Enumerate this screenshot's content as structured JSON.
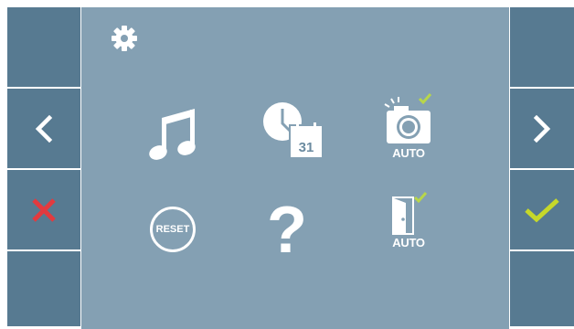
{
  "main": {
    "items": [
      {
        "name": "melody",
        "icon": "music-note-icon"
      },
      {
        "name": "date-time",
        "icon": "clock-calendar-icon",
        "calendar_day": "31"
      },
      {
        "name": "camera-auto",
        "icon": "camera-icon",
        "label": "AUTO",
        "checked": true
      },
      {
        "name": "reset",
        "icon": "reset-icon",
        "label": "RESET"
      },
      {
        "name": "help",
        "icon": "help-icon",
        "label": "?"
      },
      {
        "name": "door-auto",
        "icon": "door-icon",
        "label": "AUTO",
        "checked": true
      }
    ]
  },
  "left_panel": {
    "buttons": [
      {
        "name": "blank",
        "icon": ""
      },
      {
        "name": "prev",
        "icon": "chevron-left-icon"
      },
      {
        "name": "cancel",
        "icon": "close-icon"
      },
      {
        "name": "blank",
        "icon": ""
      }
    ]
  },
  "right_panel": {
    "buttons": [
      {
        "name": "blank",
        "icon": ""
      },
      {
        "name": "next",
        "icon": "chevron-right-icon"
      },
      {
        "name": "confirm",
        "icon": "check-icon"
      },
      {
        "name": "blank",
        "icon": ""
      }
    ]
  },
  "colors": {
    "panel": "#577a91",
    "main_bg": "#84a0b3",
    "icon": "#ffffff",
    "cancel": "#e23a3f",
    "confirm": "#c6d82a",
    "check_badge": "#b8d64a"
  }
}
